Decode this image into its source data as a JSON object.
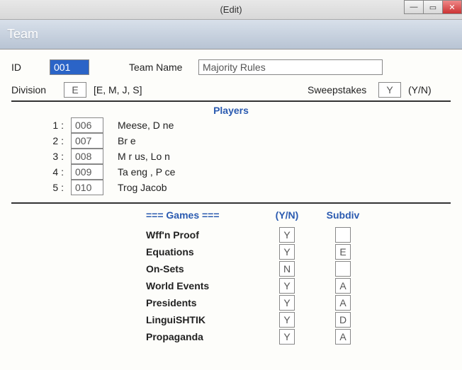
{
  "titlebar": {
    "title": "(Edit)"
  },
  "header": {
    "title": "Team"
  },
  "form": {
    "id_label": "ID",
    "id_value": "001",
    "teamname_label": "Team Name",
    "teamname_value": "Majority Rules",
    "division_label": "Division",
    "division_value": "E",
    "division_hint": "[E, M, J, S]",
    "sweep_label": "Sweepstakes",
    "sweep_value": "Y",
    "sweep_hint": "(Y/N)"
  },
  "players_title": "Players",
  "players": [
    {
      "num": "1 :",
      "id": "006",
      "name": "Meese, D ne"
    },
    {
      "num": "2 :",
      "id": "007",
      "name": "       Br   e"
    },
    {
      "num": "3 :",
      "id": "008",
      "name": "M r us, Lo  n"
    },
    {
      "num": "4 :",
      "id": "009",
      "name": "Ta eng  , P  ce"
    },
    {
      "num": "5 :",
      "id": "010",
      "name": "Trog    Jacob"
    }
  ],
  "games_header": {
    "games": "===  Games  ===",
    "yn": "(Y/N)",
    "subdiv": "Subdiv"
  },
  "games": [
    {
      "name": "Wff'n Proof",
      "yn": "Y",
      "subdiv": ""
    },
    {
      "name": "Equations",
      "yn": "Y",
      "subdiv": "E"
    },
    {
      "name": "On-Sets",
      "yn": "N",
      "subdiv": ""
    },
    {
      "name": "World Events",
      "yn": "Y",
      "subdiv": "A"
    },
    {
      "name": "Presidents",
      "yn": "Y",
      "subdiv": "A"
    },
    {
      "name": "LinguiSHTIK",
      "yn": "Y",
      "subdiv": "D"
    },
    {
      "name": "Propaganda",
      "yn": "Y",
      "subdiv": "A"
    }
  ]
}
